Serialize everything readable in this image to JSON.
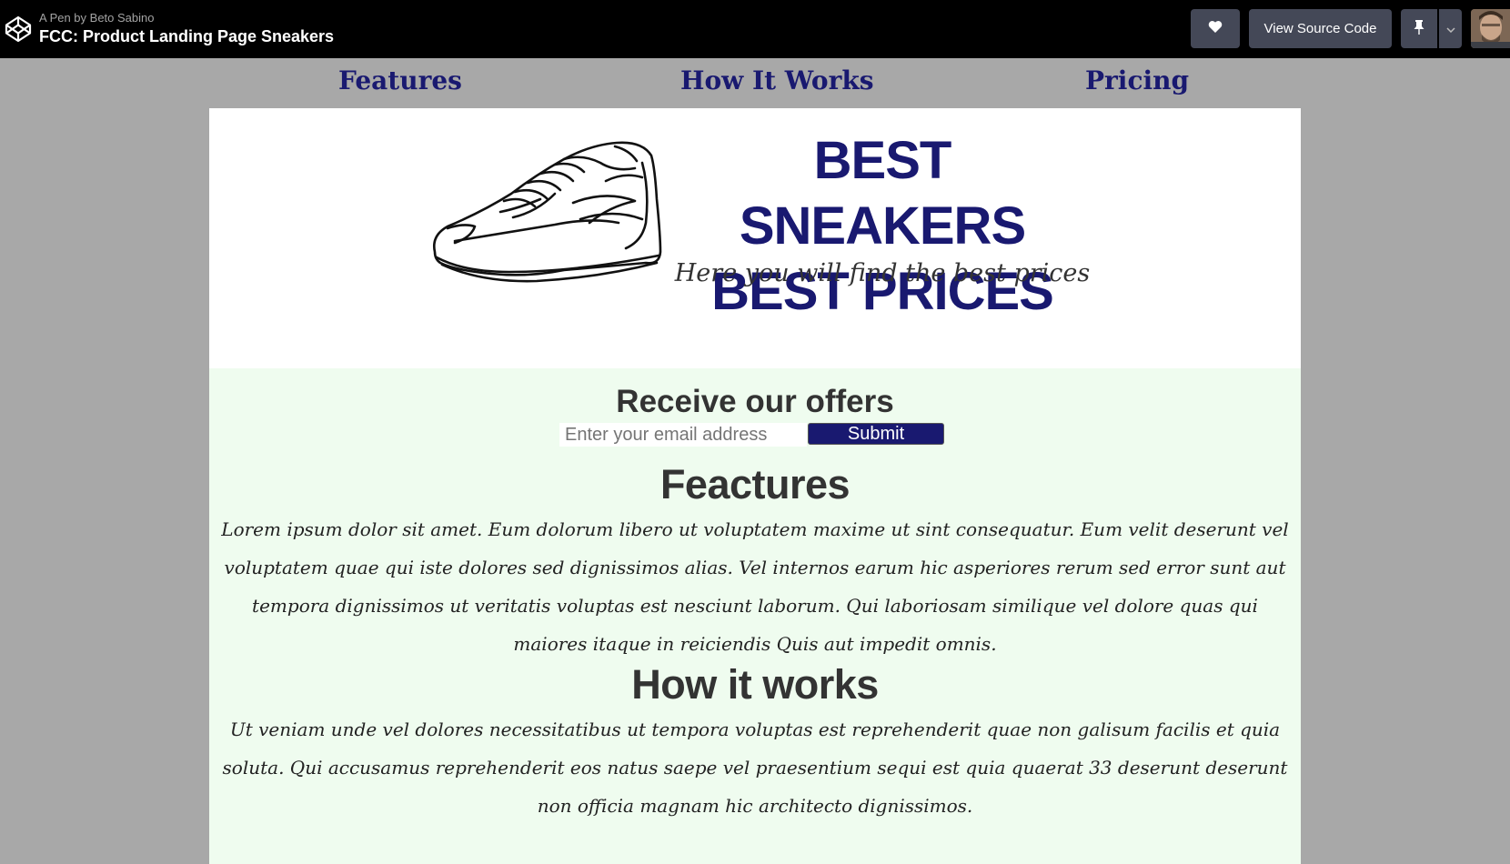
{
  "codepen": {
    "byline": "A Pen by Beto Sabino",
    "title": "FCC: Product Landing Page Sneakers",
    "view_source_label": "View Source Code",
    "icons": {
      "logo": "codepen-logo-icon",
      "heart": "heart-icon",
      "pin": "pin-icon",
      "caret": "chevron-down-icon"
    }
  },
  "nav": {
    "features": "Features",
    "how_it_works": "How It Works",
    "pricing": "Pricing"
  },
  "hero": {
    "title_line1": "BEST SNEAKERS",
    "title_line2": "BEST PRICES",
    "subtitle": "Here you will find the best prices",
    "image": "sneaker-line-drawing"
  },
  "offers": {
    "title": "Receive our offers",
    "email_placeholder": "Enter your email address",
    "submit_label": "Submit"
  },
  "features": {
    "title": "Feactures",
    "text": "Lorem ipsum dolor sit amet. Eum dolorum libero ut voluptatem maxime ut sint consequatur. Eum velit deserunt vel voluptatem quae qui iste dolores sed dignissimos alias. Vel internos earum hic asperiores rerum sed error sunt aut tempora dignissimos ut veritatis voluptas est nesciunt laborum. Qui laboriosam similique vel dolore quas qui maiores itaque in reiciendis Quis aut impedit omnis."
  },
  "how_it_works": {
    "title": "How it works",
    "text": "Ut veniam unde vel dolores necessitatibus ut tempora voluptas est reprehenderit quae non galisum facilis et quia soluta. Qui accusamus reprehenderit eos natus saepe vel praesentium sequi est quia quaerat 33 deserunt deserunt non officia magnam hic architecto dignissimos."
  },
  "colors": {
    "brand_navy": "#191970",
    "topbar": "#000000",
    "button_gray": "#444857",
    "page_bg": "#a8a8a8",
    "content_bg": "#effcef"
  }
}
